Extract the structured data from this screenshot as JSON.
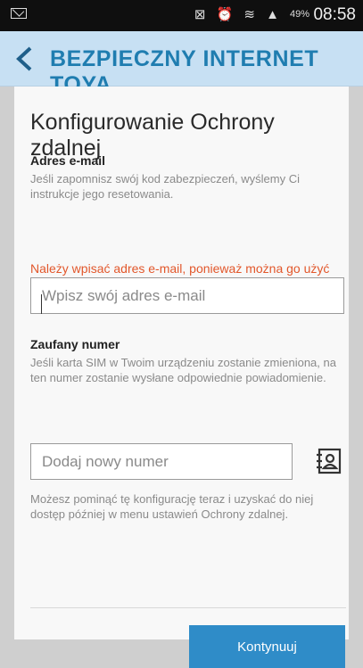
{
  "status_bar": {
    "time": "08:58",
    "battery_percent": "49%",
    "icons": [
      "mail-icon",
      "signal-icons",
      "alarm-icon",
      "wifi-icon",
      "cellular-icon",
      "battery-icon"
    ]
  },
  "app_bar": {
    "title": "BEZPIECZNY INTERNET TOYA",
    "back_icon": "chevron-left-icon",
    "background": "#c7e0f3",
    "title_color": "#1f7db0"
  },
  "page": {
    "heading": "Konfigurowanie Ochrony zdalnej",
    "email_section": {
      "label": "Adres e-mail",
      "description": "Jeśli zapomnisz swój kod zabezpieczeń, wyślemy Ci instrukcje jego resetowania.",
      "warning": "Należy wpisać adres e-mail, ponieważ można go użyć do zresetowania zapomnianego kodu zabezpieczeń.",
      "input_value": "",
      "input_placeholder": "Wpisz swój adres e-mail"
    },
    "trusted_number_section": {
      "label": "Zaufany numer",
      "description": "Jeśli karta SIM w Twoim urządzeniu zostanie zmieniona, na ten numer zostanie wysłane odpowiednie powiadomienie.",
      "input_value": "",
      "input_placeholder": "Dodaj nowy numer",
      "contact_icon": "contact-book-icon"
    },
    "skip_note": "Możesz pominąć tę konfigurację teraz i uzyskać do niej dostęp później w menu ustawień Ochrony zdalnej.",
    "continue_label": "Kontynuuj",
    "colors": {
      "warning": "#e2572b",
      "button": "#2f8cc8"
    }
  }
}
